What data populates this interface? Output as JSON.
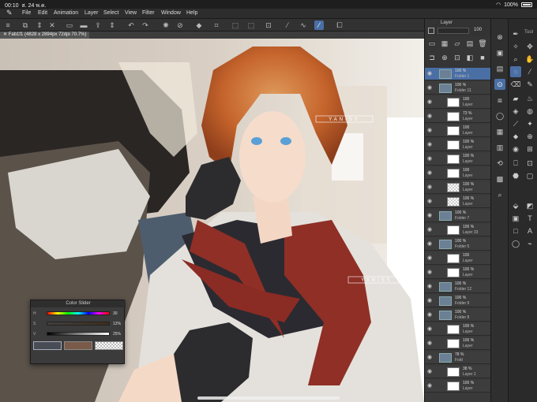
{
  "status": {
    "time": "00:10",
    "date": "ส. 24 พ.ค.",
    "battery": "100%"
  },
  "menu": {
    "items": [
      "File",
      "Edit",
      "Animation",
      "Layer",
      "Select",
      "View",
      "Filter",
      "Window",
      "Help"
    ]
  },
  "doc_tab": {
    "label": "Fab1f1 (4828 x 2894px 72dpi 70.7%)"
  },
  "watermark": {
    "text": "YANISS"
  },
  "layer_panel": {
    "title": "Layer",
    "opacity_value": "100",
    "layers": [
      {
        "pct": "100 %",
        "name": "Folder 1",
        "type": "folder"
      },
      {
        "pct": "100 %",
        "name": "Folder 11",
        "type": "folder"
      },
      {
        "pct": "100",
        "name": "Layer",
        "type": "img"
      },
      {
        "pct": "73 %",
        "name": "Layer",
        "type": "img"
      },
      {
        "pct": "100",
        "name": "Layer",
        "type": "img"
      },
      {
        "pct": "100 %",
        "name": "Layer",
        "type": "img"
      },
      {
        "pct": "100 %",
        "name": "Layer",
        "type": "img"
      },
      {
        "pct": "100",
        "name": "Layer",
        "type": "img"
      },
      {
        "pct": "100 %",
        "name": "Layer",
        "type": "chk"
      },
      {
        "pct": "100 %",
        "name": "Layer",
        "type": "chk"
      },
      {
        "pct": "100 %",
        "name": "Folder 7",
        "type": "folder"
      },
      {
        "pct": "100 %",
        "name": "Layer 33",
        "type": "img"
      },
      {
        "pct": "100 %",
        "name": "Folder 5",
        "type": "folder"
      },
      {
        "pct": "100",
        "name": "Layer",
        "type": "img"
      },
      {
        "pct": "100 %",
        "name": "Layer",
        "type": "img"
      },
      {
        "pct": "100 %",
        "name": "Folder 12",
        "type": "folder"
      },
      {
        "pct": "100 %",
        "name": "Folder 9",
        "type": "folder"
      },
      {
        "pct": "100 %",
        "name": "Folder 8",
        "type": "folder"
      },
      {
        "pct": "100 %",
        "name": "Layer",
        "type": "img"
      },
      {
        "pct": "100 %",
        "name": "Layer",
        "type": "img"
      },
      {
        "pct": "78 %",
        "name": "Fold",
        "type": "folder"
      },
      {
        "pct": "38 %",
        "name": "Layer 1",
        "type": "img"
      },
      {
        "pct": "100 %",
        "name": "Layer",
        "type": "img"
      }
    ]
  },
  "color_slider": {
    "title": "Color Slider",
    "rows": [
      {
        "label": "H",
        "value": "30"
      },
      {
        "label": "S",
        "value": "12%"
      },
      {
        "label": "V",
        "value": "25%"
      }
    ],
    "main_color": "#474c55",
    "sub_color": "#7a5a48"
  },
  "tool_panel_label": "Tool"
}
